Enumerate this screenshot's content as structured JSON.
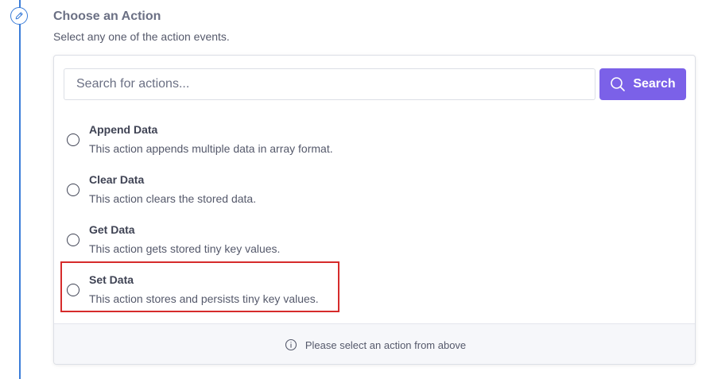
{
  "step": {
    "icon": "pencil-icon",
    "title": "Choose an Action",
    "subtitle": "Select any one of the action events."
  },
  "search": {
    "placeholder": "Search for actions...",
    "value": "",
    "button_label": "Search",
    "button_icon": "search-icon",
    "accent_color": "#7b61e8"
  },
  "actions": [
    {
      "title": "Append Data",
      "description": "This action appends multiple data in array format."
    },
    {
      "title": "Clear Data",
      "description": "This action clears the stored data."
    },
    {
      "title": "Get Data",
      "description": "This action gets stored tiny key values."
    },
    {
      "title": "Set Data",
      "description": "This action stores and persists tiny key values."
    }
  ],
  "highlight_color": "#d62b2b",
  "footer": {
    "icon": "info-icon",
    "message": "Please select an action from above"
  }
}
